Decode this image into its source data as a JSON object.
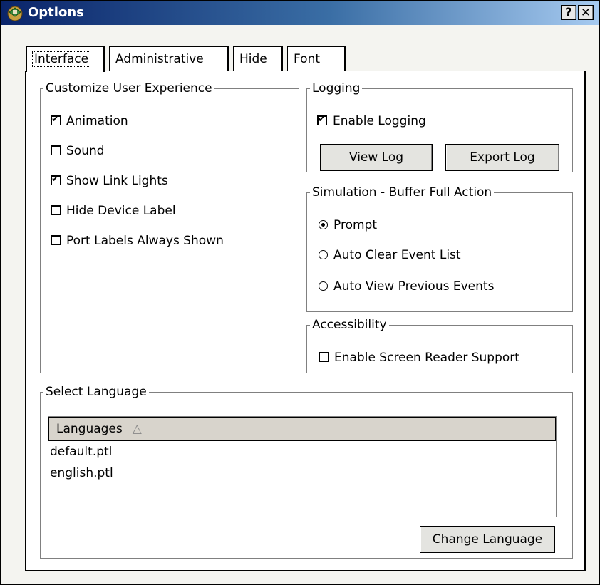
{
  "window": {
    "title": "Options",
    "help_label": "?",
    "close_label": "✕"
  },
  "tabs": [
    {
      "label": "Interface",
      "active": true
    },
    {
      "label": "Administrative"
    },
    {
      "label": "Hide"
    },
    {
      "label": "Font"
    }
  ],
  "customize": {
    "legend": "Customize User Experience",
    "options": [
      {
        "label": "Animation",
        "checked": true
      },
      {
        "label": "Sound",
        "checked": false
      },
      {
        "label": "Show Link Lights",
        "checked": true
      },
      {
        "label": "Hide Device Label",
        "checked": false
      },
      {
        "label": "Port Labels Always Shown",
        "checked": false
      }
    ]
  },
  "logging": {
    "legend": "Logging",
    "enable_label": "Enable Logging",
    "enable_checked": true,
    "view_log": "View Log",
    "export_log": "Export Log"
  },
  "simulation": {
    "legend": "Simulation - Buffer Full Action",
    "options": [
      {
        "label": "Prompt",
        "selected": true
      },
      {
        "label": "Auto Clear Event List",
        "selected": false
      },
      {
        "label": "Auto View Previous Events",
        "selected": false
      }
    ]
  },
  "accessibility": {
    "legend": "Accessibility",
    "screen_reader_label": "Enable Screen Reader Support",
    "screen_reader_checked": false
  },
  "language": {
    "legend": "Select Language",
    "column_header": "Languages",
    "sort_icon": "△",
    "items": [
      "default.ptl",
      "english.ptl"
    ],
    "change_button": "Change Language"
  }
}
